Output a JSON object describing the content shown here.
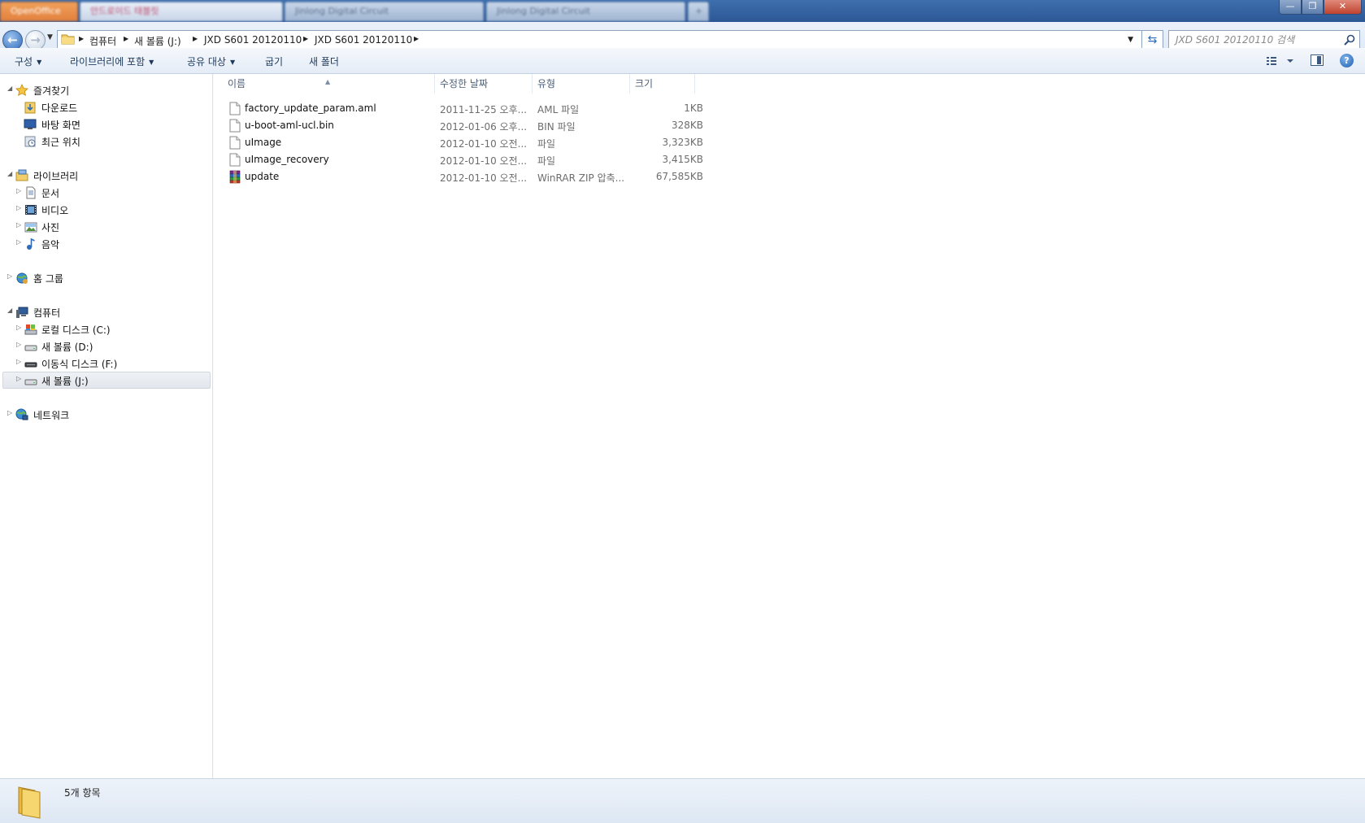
{
  "titlebar": {
    "tabs": [
      "OpenOffice",
      "안드로이드 태블릿",
      "Jinlong Digital Circuit",
      "Jinlong Digital Circuit",
      "+"
    ],
    "min_label": "—",
    "max_label": "❐",
    "close_label": "✕"
  },
  "address": {
    "crumbs": [
      "컴퓨터",
      "새 볼륨 (J:)",
      "JXD S601 20120110",
      "JXD S601 20120110"
    ],
    "search_placeholder": "JXD S601 20120110 검색"
  },
  "toolbar": {
    "organize": "구성",
    "include_library": "라이브러리에 포함",
    "share_with": "공유 대상",
    "burn": "굽기",
    "new_folder": "새 폴더"
  },
  "nav": {
    "favorites": "즐겨찾기",
    "downloads": "다운로드",
    "desktop": "바탕 화면",
    "recent": "최근 위치",
    "libraries": "라이브러리",
    "documents": "문서",
    "videos": "비디오",
    "pictures": "사진",
    "music": "음악",
    "homegroup": "홈 그룹",
    "computer": "컴퓨터",
    "drive_c": "로컬 디스크 (C:)",
    "drive_d": "새 볼륨 (D:)",
    "drive_f": "이동식 디스크 (F:)",
    "drive_j": "새 볼륨 (J:)",
    "network": "네트워크"
  },
  "columns": {
    "name": "이름",
    "date": "수정한 날짜",
    "type": "유형",
    "size": "크기"
  },
  "files": [
    {
      "name": "factory_update_param.aml",
      "date": "2011-11-25 오후...",
      "type": "AML 파일",
      "size": "1KB",
      "icon": "file-icon"
    },
    {
      "name": "u-boot-aml-ucl.bin",
      "date": "2012-01-06 오후...",
      "type": "BIN 파일",
      "size": "328KB",
      "icon": "file-icon"
    },
    {
      "name": "uImage",
      "date": "2012-01-10 오전...",
      "type": "파일",
      "size": "3,323KB",
      "icon": "file-icon"
    },
    {
      "name": "uImage_recovery",
      "date": "2012-01-10 오전...",
      "type": "파일",
      "size": "3,415KB",
      "icon": "file-icon"
    },
    {
      "name": "update",
      "date": "2012-01-10 오전...",
      "type": "WinRAR ZIP 압축...",
      "size": "67,585KB",
      "icon": "winrar-archive-icon"
    }
  ],
  "status": {
    "item_count": "5개 항목"
  },
  "colors": {
    "titlebar": "#2c5795",
    "accent": "#2e6bb8",
    "selection": "#e3e7ed"
  }
}
